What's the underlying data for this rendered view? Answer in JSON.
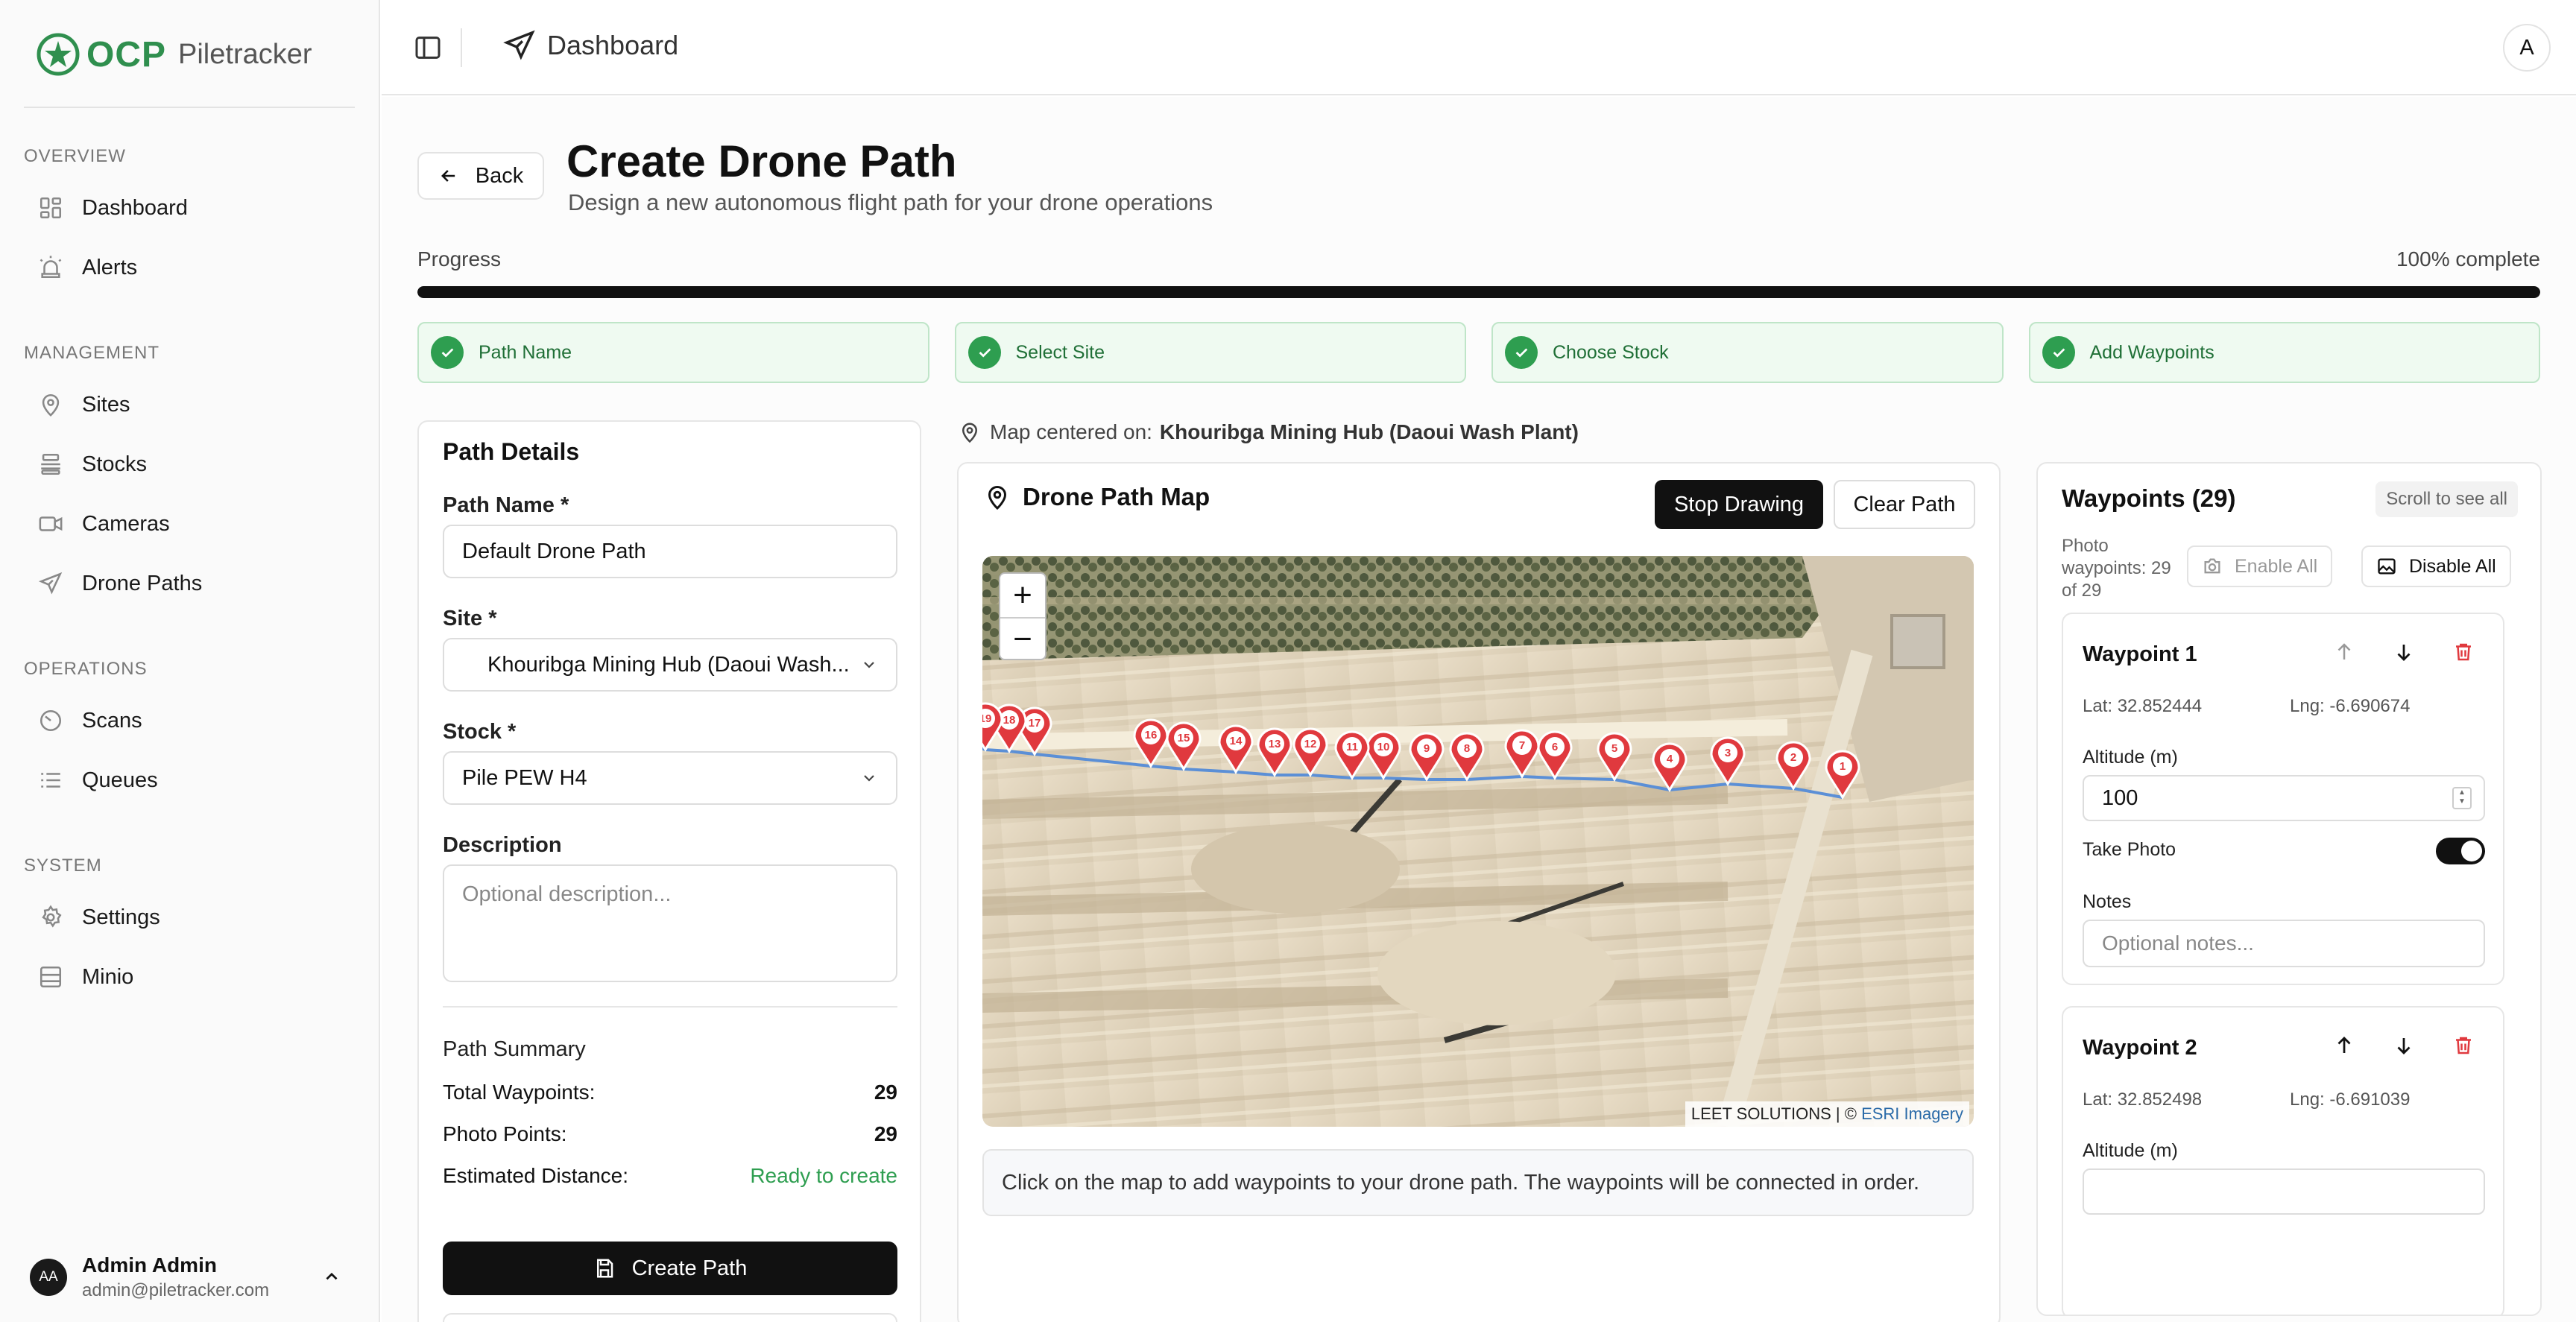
{
  "brand": {
    "logo_text": "OCP",
    "product": "Piletracker"
  },
  "sidebar": {
    "sections": [
      {
        "title": "OVERVIEW",
        "items": [
          {
            "label": "Dashboard",
            "icon": "dashboard-icon"
          },
          {
            "label": "Alerts",
            "icon": "alarm-icon"
          }
        ]
      },
      {
        "title": "MANAGEMENT",
        "items": [
          {
            "label": "Sites",
            "icon": "map-pin-icon"
          },
          {
            "label": "Stocks",
            "icon": "stack-icon"
          },
          {
            "label": "Cameras",
            "icon": "video-icon"
          },
          {
            "label": "Drone Paths",
            "icon": "plane-icon"
          }
        ]
      },
      {
        "title": "OPERATIONS",
        "items": [
          {
            "label": "Scans",
            "icon": "scan-icon"
          },
          {
            "label": "Queues",
            "icon": "list-icon"
          }
        ]
      },
      {
        "title": "SYSTEM",
        "items": [
          {
            "label": "Settings",
            "icon": "gear-icon"
          },
          {
            "label": "Minio",
            "icon": "server-icon"
          }
        ]
      }
    ],
    "user": {
      "initials": "AA",
      "name": "Admin Admin",
      "email": "admin@piletracker.com"
    }
  },
  "header": {
    "breadcrumb": "Dashboard",
    "account_initial": "A"
  },
  "page": {
    "back_label": "Back",
    "title": "Create Drone Path",
    "subtitle": "Design a new autonomous flight path for your drone operations",
    "progress_label": "Progress",
    "progress_text": "100% complete",
    "progress_value": 100,
    "steps": [
      "Path Name",
      "Select Site",
      "Choose Stock",
      "Add Waypoints"
    ]
  },
  "details": {
    "heading": "Path Details",
    "path_name_label": "Path Name *",
    "path_name_value": "Default Drone Path",
    "site_label": "Site *",
    "site_value": "Khouribga Mining Hub (Daoui Wash...",
    "stock_label": "Stock *",
    "stock_value": "Pile PEW H4",
    "description_label": "Description",
    "description_placeholder": "Optional description...",
    "summary_heading": "Path Summary",
    "total_label": "Total Waypoints:",
    "total_value": "29",
    "photo_label": "Photo Points:",
    "photo_value": "29",
    "distance_label": "Estimated Distance:",
    "distance_value": "Ready to create",
    "create_label": "Create Path"
  },
  "map": {
    "centered_prefix": "Map centered on:",
    "centered_site": "Khouribga Mining Hub (Daoui Wash Plant)",
    "title": "Drone Path Map",
    "stop_label": "Stop Drawing",
    "clear_label": "Clear Path",
    "zoom_in": "+",
    "zoom_out": "−",
    "attribution_prefix": "LEET SOLUTIONS | ©",
    "attribution_link": "ESRI Imagery",
    "hint": "Click on the map to add waypoints to your drone path. The waypoints will be connected in order.",
    "marker_labels": [
      "1",
      "2",
      "3",
      "4",
      "5",
      "6",
      "7",
      "8",
      "9",
      "10",
      "11",
      "12",
      "13",
      "14",
      "15",
      "16",
      "17",
      "18",
      "19"
    ]
  },
  "waypoints": {
    "title": "Waypoints (29)",
    "scroll_hint": "Scroll to see all",
    "photo_count": "Photo waypoints: 29 of 29",
    "enable_all": "Enable All",
    "disable_all": "Disable All",
    "items": [
      {
        "title": "Waypoint 1",
        "lat": "Lat: 32.852444",
        "lng": "Lng: -6.690674",
        "altitude_label": "Altitude (m)",
        "altitude": "100",
        "photo_label": "Take Photo",
        "notes_label": "Notes",
        "notes_placeholder": "Optional notes..."
      },
      {
        "title": "Waypoint 2",
        "lat": "Lat: 32.852498",
        "lng": "Lng: -6.691039",
        "altitude_label": "Altitude (m)"
      }
    ]
  },
  "colors": {
    "brand_green": "#2f8f4e",
    "success": "#2e9e50",
    "marker_red": "#e0393e",
    "path_blue": "#5b8fd6",
    "primary": "#111111"
  }
}
